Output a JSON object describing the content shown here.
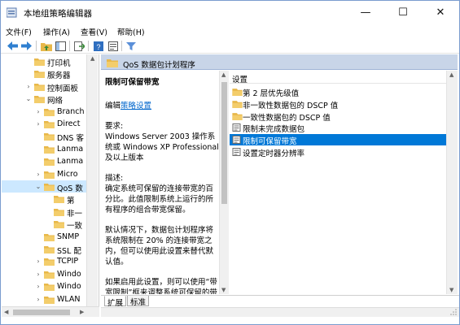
{
  "window": {
    "title": "本地组策略编辑器",
    "minimize": "—",
    "maximize": "☐",
    "close": "✕"
  },
  "menu": [
    "文件(F)",
    "操作(A)",
    "查看(V)",
    "帮助(H)"
  ],
  "toolbar_icons": [
    "back-icon",
    "forward-icon",
    "up-folder-icon",
    "show-hide-tree-icon",
    "export-list-icon",
    "help-icon",
    "properties-icon",
    "filter-icon"
  ],
  "tree": {
    "items": [
      {
        "label": "打印机",
        "level": 1,
        "expander": "",
        "selected": false
      },
      {
        "label": "服务器",
        "level": 1,
        "expander": "",
        "selected": false
      },
      {
        "label": "控制面板",
        "level": 1,
        "expander": "›",
        "selected": false
      },
      {
        "label": "网络",
        "level": 1,
        "expander": "⌄",
        "selected": false
      },
      {
        "label": "Branch",
        "level": 2,
        "expander": "›",
        "selected": false
      },
      {
        "label": "Direct",
        "level": 2,
        "expander": "›",
        "selected": false
      },
      {
        "label": "DNS 客",
        "level": 2,
        "expander": "",
        "selected": false
      },
      {
        "label": "Lanma",
        "level": 2,
        "expander": "",
        "selected": false
      },
      {
        "label": "Lanma",
        "level": 2,
        "expander": "",
        "selected": false
      },
      {
        "label": "Micro",
        "level": 2,
        "expander": "›",
        "selected": false
      },
      {
        "label": "QoS 数",
        "level": 2,
        "expander": "⌄",
        "selected": true
      },
      {
        "label": "第",
        "level": 3,
        "expander": "",
        "selected": false
      },
      {
        "label": "非一",
        "level": 3,
        "expander": "",
        "selected": false
      },
      {
        "label": "一致",
        "level": 3,
        "expander": "",
        "selected": false
      },
      {
        "label": "SNMP",
        "level": 2,
        "expander": "",
        "selected": false
      },
      {
        "label": "SSL 配",
        "level": 2,
        "expander": "",
        "selected": false
      },
      {
        "label": "TCPIP",
        "level": 2,
        "expander": "›",
        "selected": false
      },
      {
        "label": "Windo",
        "level": 2,
        "expander": "›",
        "selected": false
      },
      {
        "label": "Windo",
        "level": 2,
        "expander": "›",
        "selected": false
      },
      {
        "label": "WLAN",
        "level": 2,
        "expander": "›",
        "selected": false
      }
    ]
  },
  "header": {
    "title": "QoS 数据包计划程序"
  },
  "description": {
    "title": "限制可保留带宽",
    "edit_prefix": "编辑",
    "edit_link": "策略设置",
    "requirements_label": "要求:",
    "requirements_text": "Windows Server 2003 操作系统或 Windows XP Professional 及以上版本",
    "description_label": "描述:",
    "description_text": "确定系统可保留的连接带宽的百分比。此值限制系统上运行的所有程序的组合带宽保留。",
    "default_text": "默认情况下，数据包计划程序将系统限制在 20% 的连接带宽之内，但可以使用此设置来替代默认值。",
    "enabled_text": "如果启用此设置，则可以使用“带宽限制”框来调整系统可保留的带宽数量。"
  },
  "list": {
    "column": "设置",
    "rows": [
      {
        "label": "第 2 层优先级值",
        "type": "folder",
        "selected": false
      },
      {
        "label": "非一致性数据包的 DSCP 值",
        "type": "folder",
        "selected": false
      },
      {
        "label": "一致性数据包的 DSCP 值",
        "type": "folder",
        "selected": false
      },
      {
        "label": "限制未完成数据包",
        "type": "setting",
        "selected": false
      },
      {
        "label": "限制可保留带宽",
        "type": "setting",
        "selected": true
      },
      {
        "label": "设置定时器分辨率",
        "type": "setting",
        "selected": false
      }
    ]
  },
  "tabs": [
    "扩展",
    "标准"
  ],
  "colors": {
    "selection": "#0078d7",
    "header_band": "#c8d5e8",
    "folder": "#e8b84a",
    "link": "#0066cc"
  }
}
